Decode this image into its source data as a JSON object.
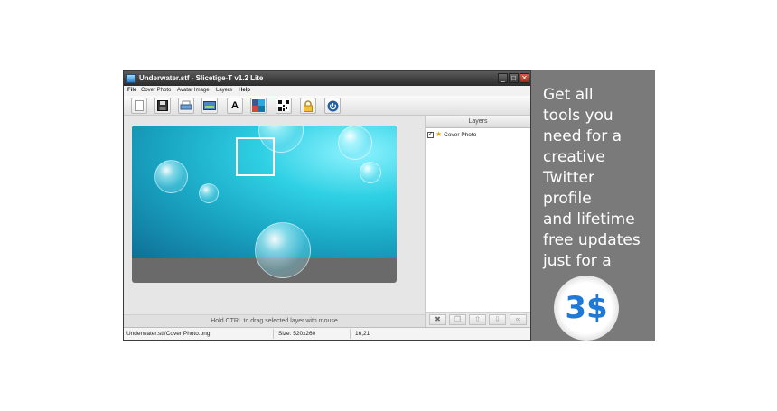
{
  "window": {
    "title": "Underwater.stf - Slicetige-T v1.2 Lite",
    "min_label": "_",
    "max_label": "□",
    "close_label": "✕"
  },
  "menu": [
    "File",
    "Cover Photo",
    "Avatar Image",
    "Layers",
    "Help"
  ],
  "toolbar": {
    "buttons": [
      {
        "icon": "new-document-icon"
      },
      {
        "icon": "save-icon"
      },
      {
        "icon": "print-icon"
      },
      {
        "icon": "cover-image-icon"
      },
      {
        "icon": "text-icon",
        "glyph": "A"
      },
      {
        "icon": "social-icon"
      },
      {
        "icon": "qr-code-icon"
      },
      {
        "icon": "lock-icon"
      },
      {
        "icon": "power-icon"
      }
    ]
  },
  "hint": "Hold CTRL to drag selected layer with mouse",
  "layers": {
    "header": "Layers",
    "items": [
      {
        "label": "Cover Photo",
        "checked": true
      }
    ],
    "tools": [
      {
        "icon": "delete-icon",
        "glyph": "✖"
      },
      {
        "icon": "duplicate-icon",
        "glyph": "❐"
      },
      {
        "icon": "move-up-icon",
        "glyph": "⇧"
      },
      {
        "icon": "move-down-icon",
        "glyph": "⇩"
      },
      {
        "icon": "link-icon",
        "glyph": "∞"
      }
    ]
  },
  "status": {
    "file": "Underwater.stf/Cover Photo.png",
    "size": "Size: 520x260",
    "coords": "16,21"
  },
  "promo": {
    "lines": [
      "Get all",
      "tools you",
      "need for a",
      "creative",
      "Twitter",
      "profile",
      "and lifetime",
      "free updates",
      "just for  a"
    ],
    "price": "3$"
  },
  "colors": {
    "promo_bg": "#7a7a7a",
    "price_text": "#1e7ad6",
    "water": "#2fd0e4"
  }
}
